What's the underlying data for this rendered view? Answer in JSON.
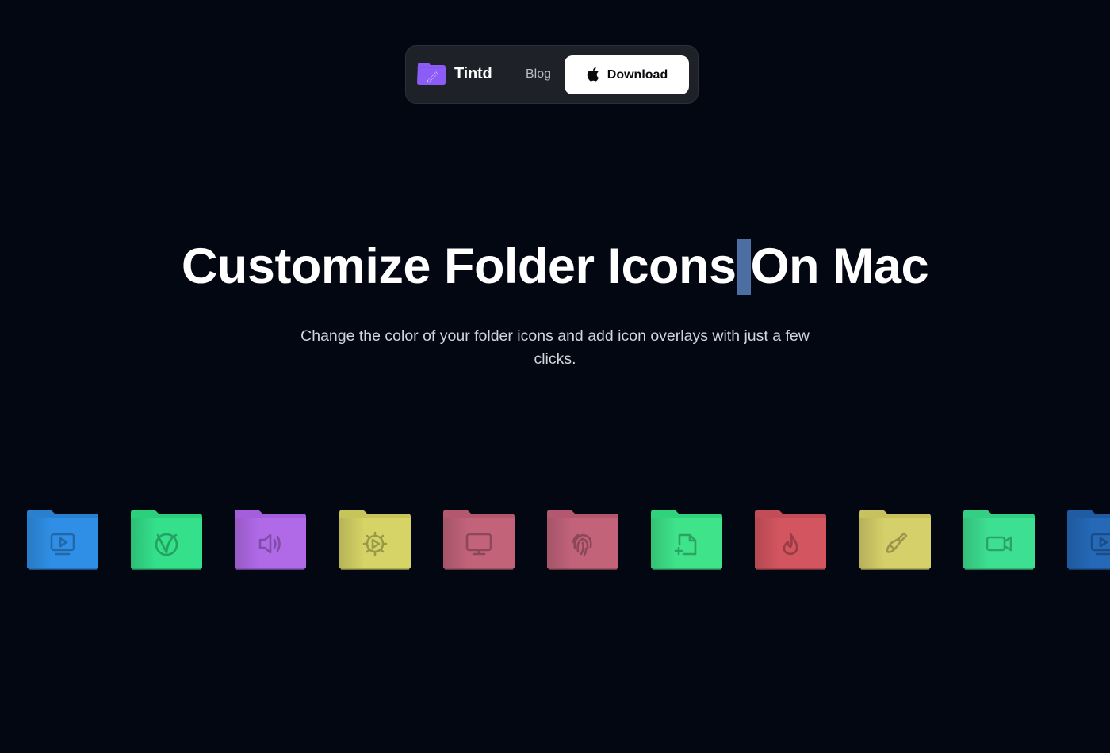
{
  "nav": {
    "brand_name": "Tintd",
    "brand_logo_icon": "folder-brush-icon",
    "brand_logo_color": "#8b5cf6",
    "blog_label": "Blog",
    "download_label": "Download",
    "download_icon": "apple-icon"
  },
  "hero": {
    "title_part1": "Customize Folder Icons",
    "title_part2": "On Mac",
    "subtitle": "Change the color of your folder icons and add icon overlays with just a few clicks."
  },
  "folders": [
    {
      "color": "#2f8fe6",
      "tab": "#2a7fcf",
      "icon": "tv-play-icon"
    },
    {
      "color": "#34e08a",
      "tab": "#2ccf7c",
      "icon": "vegan-leaf-icon"
    },
    {
      "color": "#b06ae8",
      "tab": "#a35fdb",
      "icon": "speaker-icon"
    },
    {
      "color": "#d6d466",
      "tab": "#c7c55a",
      "icon": "gear-play-icon"
    },
    {
      "color": "#c2637a",
      "tab": "#b3586e",
      "icon": "monitor-icon"
    },
    {
      "color": "#c2637a",
      "tab": "#b3586e",
      "icon": "fingerprint-icon"
    },
    {
      "color": "#3ee38a",
      "tab": "#31d27c",
      "icon": "file-plus-icon"
    },
    {
      "color": "#d35560",
      "tab": "#c44c57",
      "icon": "flame-icon"
    },
    {
      "color": "#d6d06a",
      "tab": "#c7c15e",
      "icon": "paintbrush-icon"
    },
    {
      "color": "#3ddf90",
      "tab": "#33d083",
      "icon": "video-camera-icon"
    },
    {
      "color": "#2569b8",
      "tab": "#205ca3",
      "icon": "tv-play-icon"
    }
  ]
}
